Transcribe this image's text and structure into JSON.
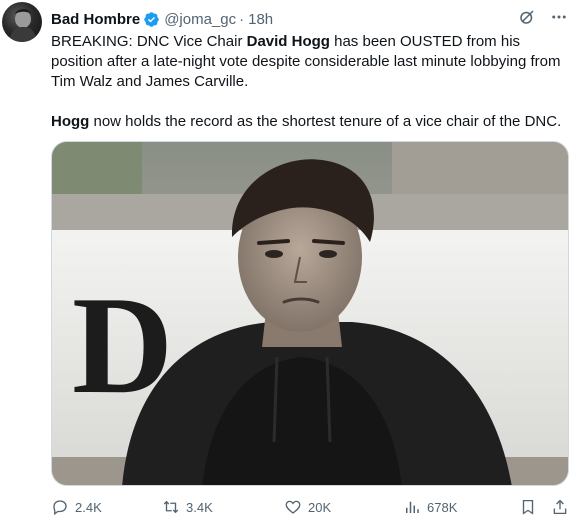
{
  "author": {
    "display_name": "Bad Hombre",
    "handle": "@joma_gc",
    "separator": "·",
    "timestamp": "18h",
    "verified_color": "#1d9bf0"
  },
  "tweet": {
    "line1_a": "BREAKING: DNC Vice Chair ",
    "line1_bold": "David Hogg",
    "line1_b": " has been OUSTED from his position after a late-night vote despite considerable last minute lobbying from Tim Walz and James Carville.",
    "line2_bold": "Hogg",
    "line2_rest": " now holds the record as the shortest tenure of a vice chair of the DNC."
  },
  "media": {
    "sign_letter": "D"
  },
  "metrics": {
    "replies": "2.4K",
    "reposts": "3.4K",
    "likes": "20K",
    "views": "678K"
  },
  "icons": {
    "header": [
      "grok-icon",
      "more-icon"
    ],
    "actions": [
      "reply-icon",
      "repost-icon",
      "like-icon",
      "views-icon",
      "bookmark-icon",
      "share-icon"
    ]
  },
  "colors": {
    "text": "#0f1419",
    "muted": "#536471",
    "border": "#cfd9de"
  }
}
